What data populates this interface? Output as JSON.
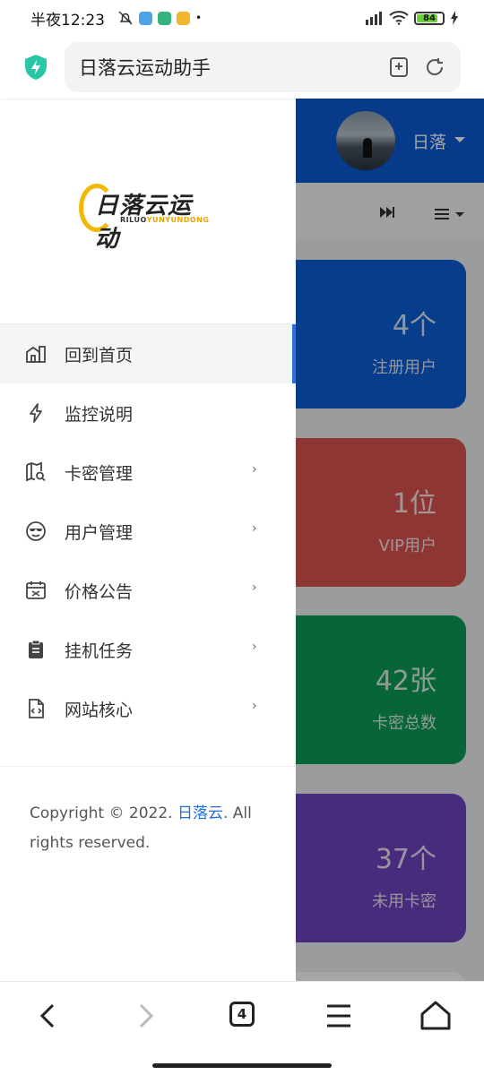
{
  "status_bar": {
    "time": "半夜12:23",
    "battery": "84",
    "battery_level_percent": 84
  },
  "browser": {
    "title": "日落云运动助手",
    "tab_count": "4"
  },
  "header": {
    "user_name": "日落"
  },
  "stats": [
    {
      "value": "4个",
      "label": "注册用户",
      "color": "#0d5fd6"
    },
    {
      "value": "1位",
      "label": "VIP用户",
      "color": "#d9534f"
    },
    {
      "value": "42张",
      "label": "卡密总数",
      "color": "#0c9b57"
    },
    {
      "value": "37个",
      "label": "未用卡密",
      "color": "#6f42c1"
    }
  ],
  "sidebar": {
    "logo_text": "日落云运动",
    "logo_sub_a": "RILUO",
    "logo_sub_b": "YUNYUNDONG",
    "items": [
      {
        "label": "回到首页",
        "icon": "home-icon",
        "active": true,
        "has_children": false
      },
      {
        "label": "监控说明",
        "icon": "bolt-icon",
        "active": false,
        "has_children": false
      },
      {
        "label": "卡密管理",
        "icon": "map-search-icon",
        "active": false,
        "has_children": true
      },
      {
        "label": "用户管理",
        "icon": "cool-face-icon",
        "active": false,
        "has_children": true
      },
      {
        "label": "价格公告",
        "icon": "calendar-icon",
        "active": false,
        "has_children": true
      },
      {
        "label": "挂机任务",
        "icon": "clipboard-icon",
        "active": false,
        "has_children": true
      },
      {
        "label": "网站核心",
        "icon": "code-file-icon",
        "active": false,
        "has_children": true
      }
    ],
    "chevron": "›",
    "footer": {
      "prefix": "Copyright © 2022.",
      "link": "日落云.",
      "suffix": "All rights reserved."
    }
  },
  "colors": {
    "accent": "#2d6fe0",
    "topbar": "#0b5bd3"
  }
}
